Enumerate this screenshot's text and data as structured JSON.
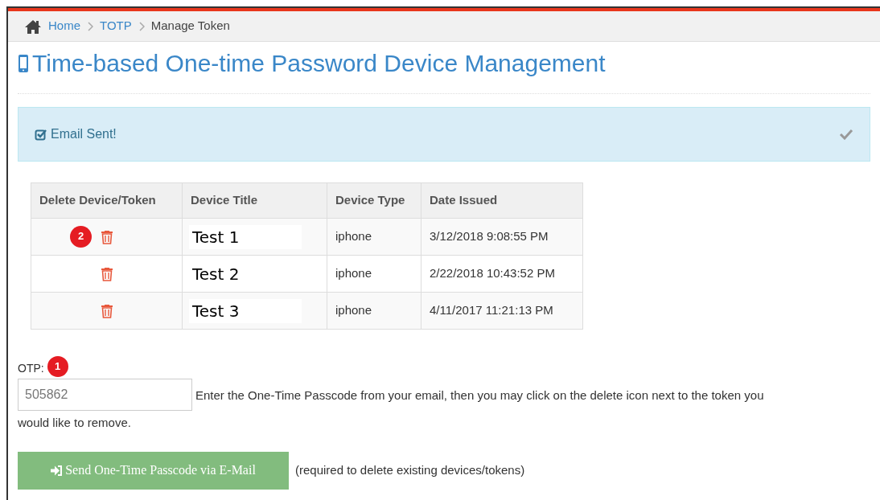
{
  "breadcrumb": [
    {
      "label": "Home",
      "link": true
    },
    {
      "label": "TOTP",
      "link": true
    },
    {
      "label": "Manage Token",
      "link": false
    }
  ],
  "title": "Time-based One-time Password Device Management",
  "alert": {
    "message": "Email Sent!"
  },
  "table": {
    "columns": [
      "Delete Device/Token",
      "Device Title",
      "Device Type",
      "Date Issued"
    ],
    "rows": [
      {
        "badge": "2",
        "title": "Test 1",
        "type": "iphone",
        "date": "3/12/2018 9:08:55 PM"
      },
      {
        "title": "Test 2",
        "type": "iphone",
        "date": "2/22/2018 10:43:52 PM"
      },
      {
        "title": "Test 3",
        "type": "iphone",
        "date": "4/11/2017 11:21:13 PM"
      }
    ]
  },
  "otp": {
    "label": "OTP:",
    "badge": "1",
    "value": "505862",
    "help_lines": [
      "Enter the One-Time Passcode from your email, then you may click on the delete icon next to the token you",
      "would like to remove."
    ]
  },
  "send_button": {
    "label": "Send One-Time Passcode via E-Mail",
    "note": "(required to delete existing devices/tokens)"
  }
}
